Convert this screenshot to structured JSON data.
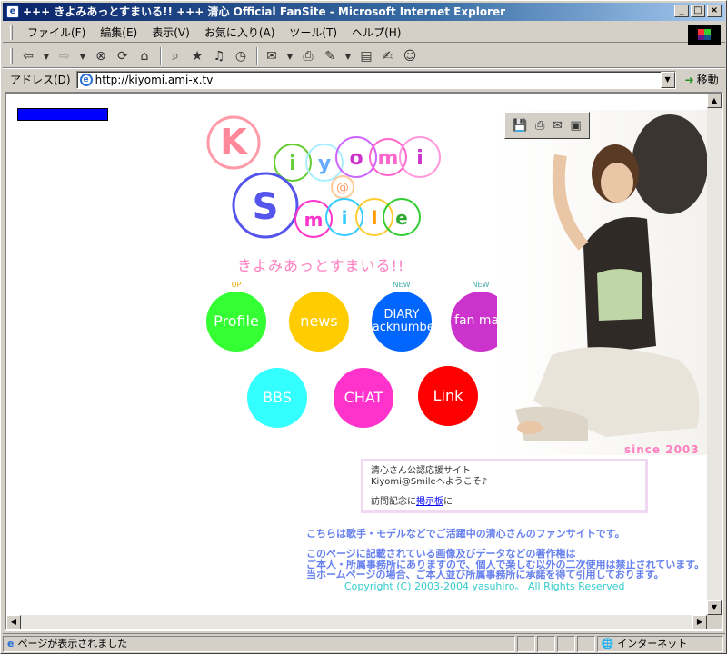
{
  "window": {
    "title": "+++ きよみあっとすまいる!! +++ 清心 Official FanSite - Microsoft Internet Explorer",
    "minimize": "_",
    "maximize": "□",
    "close": "×"
  },
  "menu": {
    "items": [
      "ファイル(F)",
      "編集(E)",
      "表示(V)",
      "お気に入り(A)",
      "ツール(T)",
      "ヘルプ(H)"
    ]
  },
  "address": {
    "label": "アドレス(D)",
    "url": "http://kiyomi.ami-x.tv",
    "go_label": "移動"
  },
  "page": {
    "logo_letters": [
      "K",
      "i",
      "y",
      "o",
      "m",
      "i",
      "@",
      "S",
      "m",
      "i",
      "l",
      "e"
    ],
    "subtitle": "きよみあっとすまいる!!",
    "nav": [
      {
        "label": "Profile",
        "badge": "UP",
        "color": "#33ff33"
      },
      {
        "label": "news",
        "badge": "",
        "color": "#ffcc00"
      },
      {
        "label": "DIARY\nBacknumber",
        "badge": "NEW",
        "color": "#0066ff"
      },
      {
        "label": "fan map",
        "badge": "NEW",
        "color": "#cc33cc"
      },
      {
        "label": "BBS",
        "badge": "",
        "color": "#33ffff"
      },
      {
        "label": "CHAT",
        "badge": "",
        "color": "#ff33cc"
      },
      {
        "label": "Link",
        "badge": "",
        "color": "#ff0000"
      }
    ],
    "since": "since 2003",
    "info": {
      "line1": "清心さん公認応援サイト",
      "line2": "Kiyomi@Smileへようこそ♪",
      "line3_prefix": "訪問記念に",
      "line3_link": "掲示板",
      "line3_suffix": "に"
    },
    "desc1": "こちらは歌手・モデルなどでご活躍中の清心さんのファンサイトです。",
    "desc2": "このページに記載されている画像及びデータなどの著作権は",
    "desc3": "ご本人・所属事務所にありますので、個人で楽しむ以外の二次使用は禁止されています。",
    "desc4": "当ホームページの場合、ご本人並び所属事務所に承諾を得て引用しております。",
    "copyright": "Copyright (C) 2003-2004 yasuhiro。 All Rights Reserved"
  },
  "status": {
    "text": "ページが表示されました",
    "zone": "インターネット"
  }
}
